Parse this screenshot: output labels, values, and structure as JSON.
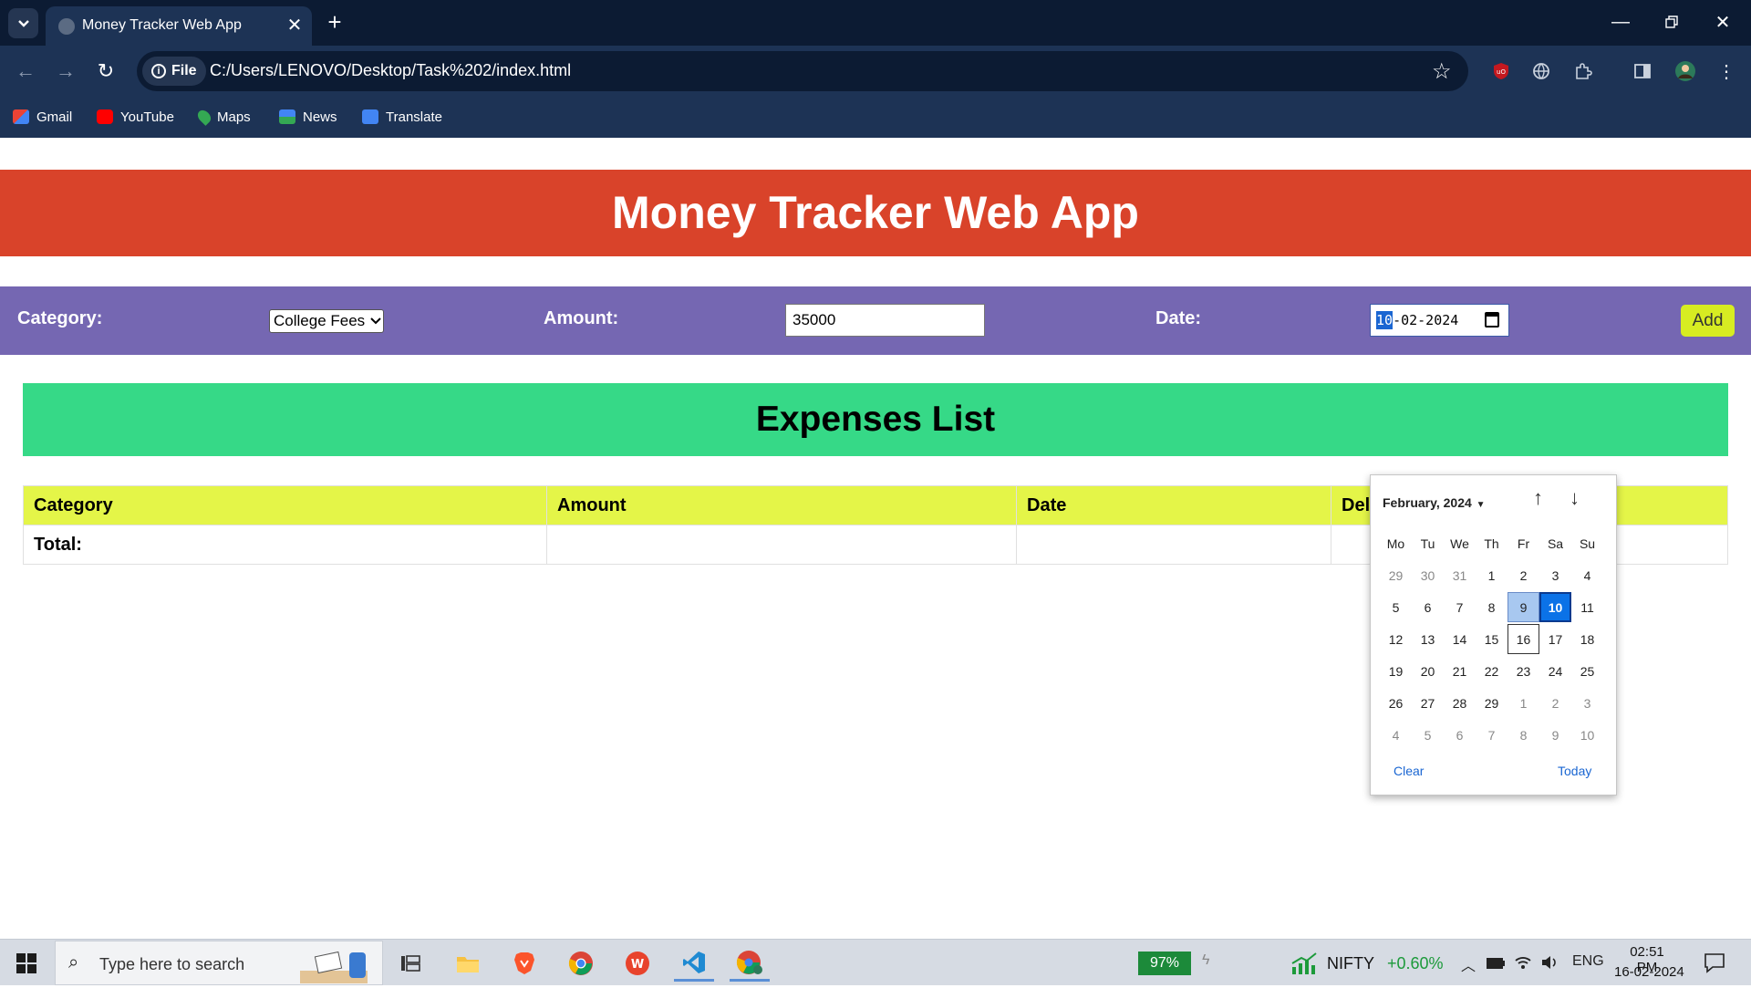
{
  "browser": {
    "tab_title": "Money Tracker Web App",
    "file_chip": "File",
    "url": "C:/Users/LENOVO/Desktop/Task%202/index.html",
    "bookmarks": [
      {
        "label": "Gmail",
        "icon": "gmail-icon",
        "color": "#ea4335"
      },
      {
        "label": "YouTube",
        "icon": "youtube-icon",
        "color": "#ff0000"
      },
      {
        "label": "Maps",
        "icon": "maps-icon",
        "color": "#34a853"
      },
      {
        "label": "News",
        "icon": "news-icon",
        "color": "#4285f4"
      },
      {
        "label": "Translate",
        "icon": "translate-icon",
        "color": "#4285f4"
      }
    ]
  },
  "app": {
    "title": "Money Tracker Web App",
    "form": {
      "category_label": "Category:",
      "category_value": "College Fees",
      "amount_label": "Amount:",
      "amount_value": "35000",
      "date_label": "Date:",
      "date_day": "10",
      "date_rest": "-02-2024",
      "add_label": "Add"
    },
    "expenses_title": "Expenses List",
    "table": {
      "headers": [
        "Category",
        "Amount",
        "Date",
        "Delete"
      ],
      "total_label": "Total:"
    },
    "colors": {
      "header": "#d9432a",
      "form_bar": "#7567b2",
      "expenses": "#36d987",
      "table_head": "#e4f548",
      "add_button": "#d7ec22"
    }
  },
  "datepicker": {
    "month": "February, 2024",
    "weekdays": [
      "Mo",
      "Tu",
      "We",
      "Th",
      "Fr",
      "Sa",
      "Su"
    ],
    "weeks": [
      [
        "29",
        "30",
        "31",
        "1",
        "2",
        "3",
        "4"
      ],
      [
        "5",
        "6",
        "7",
        "8",
        "9",
        "10",
        "11"
      ],
      [
        "12",
        "13",
        "14",
        "15",
        "16",
        "17",
        "18"
      ],
      [
        "19",
        "20",
        "21",
        "22",
        "23",
        "24",
        "25"
      ],
      [
        "26",
        "27",
        "28",
        "29",
        "1",
        "2",
        "3"
      ],
      [
        "4",
        "5",
        "6",
        "7",
        "8",
        "9",
        "10"
      ]
    ],
    "selected": "10",
    "clear_label": "Clear",
    "today_label": "Today"
  },
  "taskbar": {
    "search_placeholder": "Type here to search",
    "battery": "97%",
    "nifty_label": "NIFTY",
    "nifty_change": "+0.60%",
    "lang": "ENG",
    "time": "02:51 PM",
    "date": "16-02-2024"
  }
}
